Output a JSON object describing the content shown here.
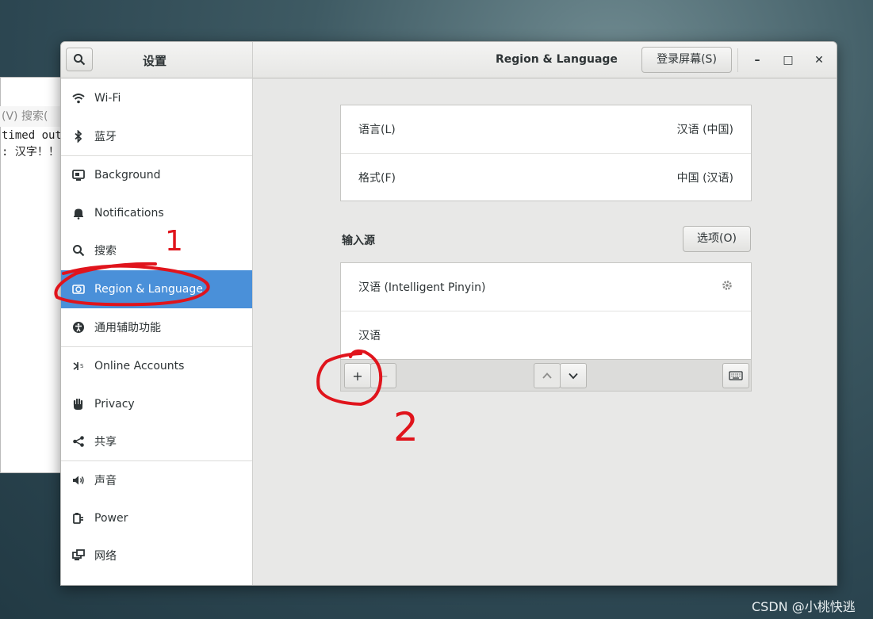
{
  "background_window": {
    "menu_text": "(V)  搜索(",
    "line1": "timed out",
    "line2": ": 汉字！！"
  },
  "titlebar": {
    "left_title": "设置",
    "main_title": "Region & Language",
    "login_button": "登录屏幕(S)",
    "minimize": "–",
    "maximize": "□",
    "close": "✕"
  },
  "sidebar": {
    "items": [
      {
        "label": "Wi-Fi",
        "icon": "wifi-icon"
      },
      {
        "label": "蓝牙",
        "icon": "bluetooth-icon"
      },
      {
        "label": "Background",
        "icon": "background-icon"
      },
      {
        "label": "Notifications",
        "icon": "bell-icon"
      },
      {
        "label": "搜索",
        "icon": "search-icon"
      },
      {
        "label": "Region & Language",
        "icon": "region-icon",
        "active": true
      },
      {
        "label": "通用辅助功能",
        "icon": "accessibility-icon"
      },
      {
        "label": "Online Accounts",
        "icon": "online-accounts-icon"
      },
      {
        "label": "Privacy",
        "icon": "hand-icon"
      },
      {
        "label": "共享",
        "icon": "share-icon"
      },
      {
        "label": "声音",
        "icon": "speaker-icon"
      },
      {
        "label": "Power",
        "icon": "power-icon"
      },
      {
        "label": "网络",
        "icon": "network-icon"
      }
    ]
  },
  "language_card": {
    "language_label": "语言(L)",
    "language_value": "汉语 (中国)",
    "format_label": "格式(F)",
    "format_value": "中国 (汉语)"
  },
  "input_sources": {
    "title": "输入源",
    "options_button": "选项(O)",
    "items": [
      "汉语 (Intelligent Pinyin)",
      "汉语"
    ],
    "add_label": "+",
    "remove_label": "−"
  },
  "annotations": {
    "mark1": "1",
    "mark2": "2"
  },
  "watermark": "CSDN @小桃快逃",
  "colors": {
    "accent": "#4a90d9",
    "annotation": "#e0141c"
  }
}
